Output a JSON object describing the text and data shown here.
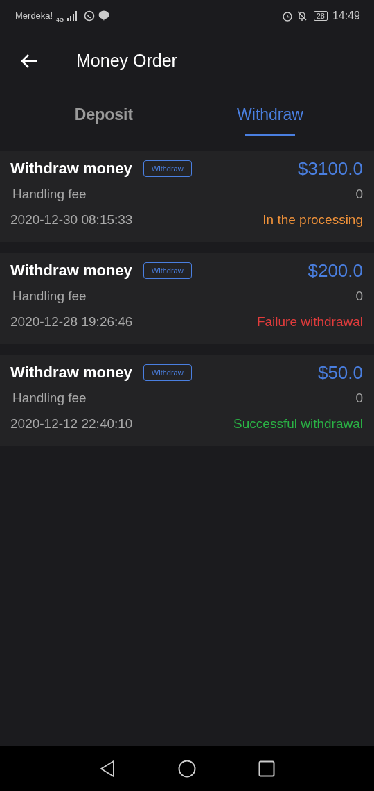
{
  "status_bar": {
    "carrier": "Merdeka!",
    "network": "4G",
    "battery": "28",
    "time": "14:49"
  },
  "header": {
    "title": "Money Order"
  },
  "tabs": [
    {
      "label": "Deposit",
      "selected": false
    },
    {
      "label": "Withdraw",
      "selected": true
    }
  ],
  "orders": [
    {
      "title": "Withdraw money",
      "tag": "Withdraw",
      "amount": "$3100.0",
      "fee_label": "Handling fee",
      "fee": "0",
      "datetime": "2020-12-30 08:15:33",
      "status": "In the processing",
      "kind": "processing"
    },
    {
      "title": "Withdraw money",
      "tag": "Withdraw",
      "amount": "$200.0",
      "fee_label": "Handling fee",
      "fee": "0",
      "datetime": "2020-12-28 19:26:46",
      "status": "Failure withdrawal",
      "kind": "failure"
    },
    {
      "title": "Withdraw money",
      "tag": "Withdraw",
      "amount": "$50.0",
      "fee_label": "Handling fee",
      "fee": "0",
      "datetime": "2020-12-12 22:40:10",
      "status": "Successful withdrawal",
      "kind": "success"
    }
  ]
}
